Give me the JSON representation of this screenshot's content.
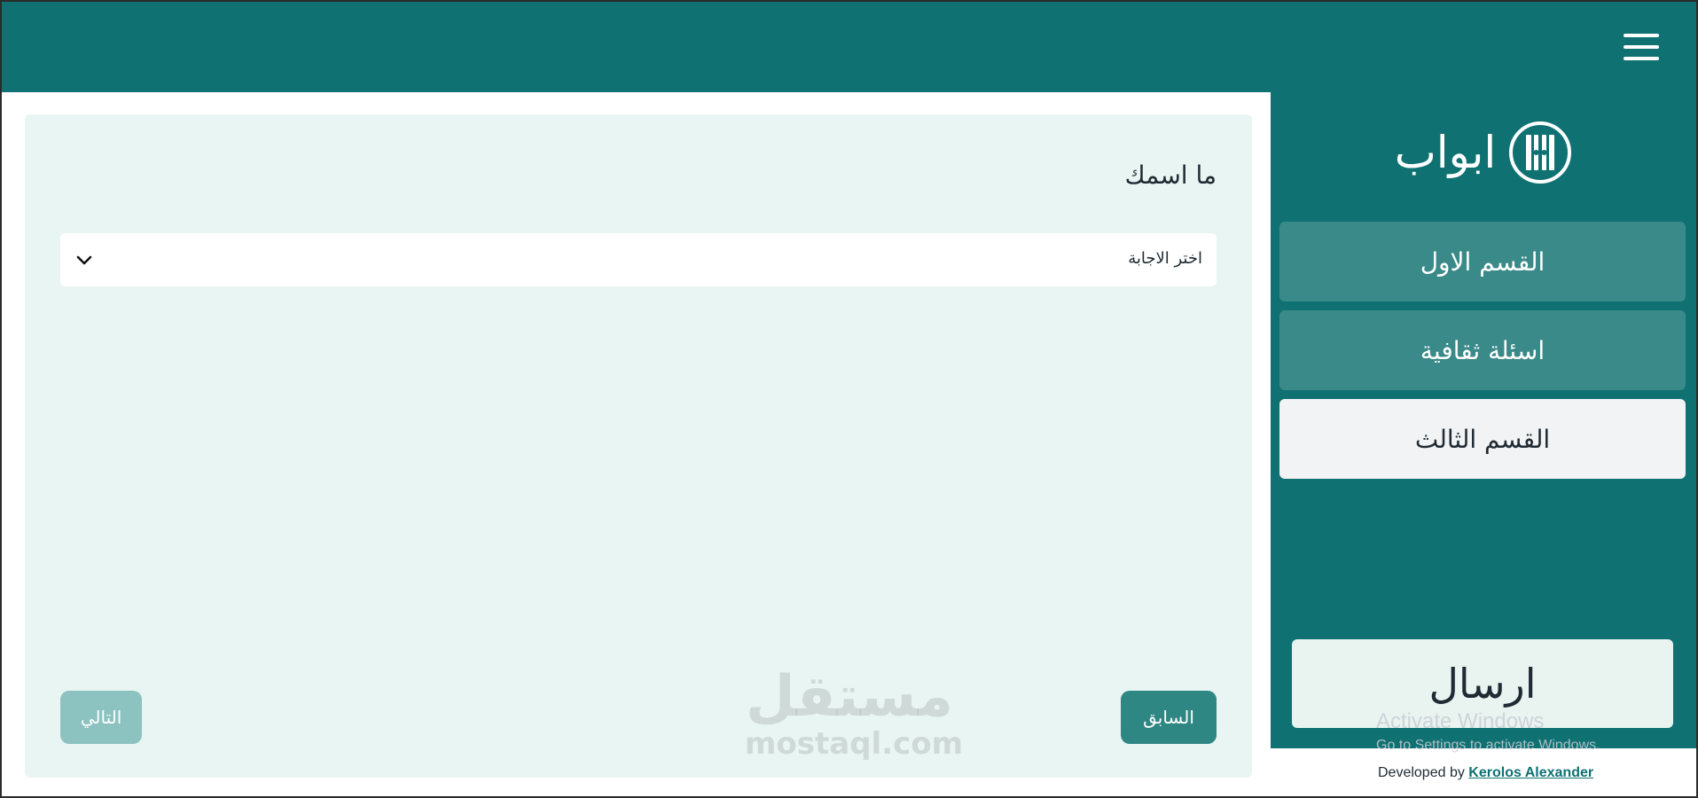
{
  "header": {
    "menu_icon": "hamburger-menu-icon",
    "background_color": "#107173"
  },
  "sidebar": {
    "brand": {
      "name": "ابواب",
      "logo_icon": "door-logo-icon"
    },
    "items": [
      {
        "label": "القسم الاول",
        "active": false
      },
      {
        "label": "اسئلة ثقافية",
        "active": false
      },
      {
        "label": "القسم الثالث",
        "active": true
      }
    ],
    "submit_label": "ارسال"
  },
  "main": {
    "question": "ما اسمك",
    "select": {
      "selected": "اختر الاجابة",
      "chevron_icon": "chevron-down-icon"
    },
    "prev_label": "السابق",
    "next_label": "التالي"
  },
  "watermark": {
    "arabic": "مستقل",
    "latin": "mostaql.com"
  },
  "os_overlay": {
    "line1": "Activate Windows",
    "line2": "Go to Settings to activate Windows."
  },
  "footer": {
    "prefix": "Developed by",
    "author": "Kerolos Alexander"
  },
  "colors": {
    "primary": "#107173",
    "nav_inactive": "#3a8a89",
    "card_background": "#e9f5f2",
    "prev_button": "#2f8784",
    "next_button_disabled": "#8cc2c0"
  }
}
